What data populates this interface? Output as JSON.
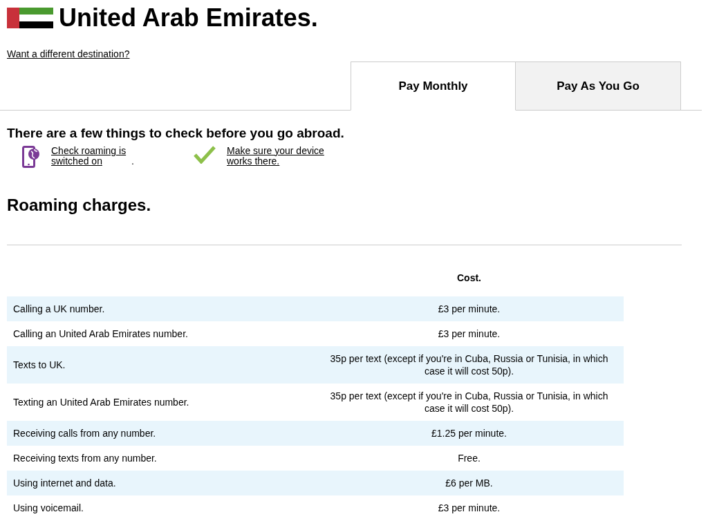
{
  "header": {
    "title": "United Arab Emirates.",
    "change_link": "Want a different destination?"
  },
  "tabs": [
    {
      "label": "Pay Monthly",
      "selected": true
    },
    {
      "label": "Pay As You Go",
      "selected": false
    }
  ],
  "checklist": {
    "heading": "There are a few things to check before you go abroad.",
    "items": [
      {
        "kind": "phone",
        "link": "Check roaming is switched on",
        "suffix": "."
      },
      {
        "kind": "tick",
        "link": "Make sure your device works there."
      }
    ]
  },
  "charges": {
    "heading": "Roaming charges.",
    "columns": [
      "Cost."
    ],
    "rows": [
      {
        "item": "Calling a UK number.",
        "cost": "£3 per minute."
      },
      {
        "item": "Calling an United Arab Emirates number.",
        "cost": "£3 per minute."
      },
      {
        "item": "Texts to UK.",
        "cost": "35p per text (except if you're in Cuba, Russia or Tunisia, in which case it will cost 50p)."
      },
      {
        "item": "Texting an United Arab Emirates number.",
        "cost": "35p per text (except if you're in Cuba, Russia or Tunisia, in which case it will cost 50p)."
      },
      {
        "item": "Receiving calls from any number.",
        "cost": "£1.25 per minute."
      },
      {
        "item": "Receiving texts from any number.",
        "cost": "Free."
      },
      {
        "item": "Using internet and data.",
        "cost": "£6 per MB."
      },
      {
        "item": "Using voicemail.",
        "cost": "£3 per minute."
      }
    ]
  }
}
